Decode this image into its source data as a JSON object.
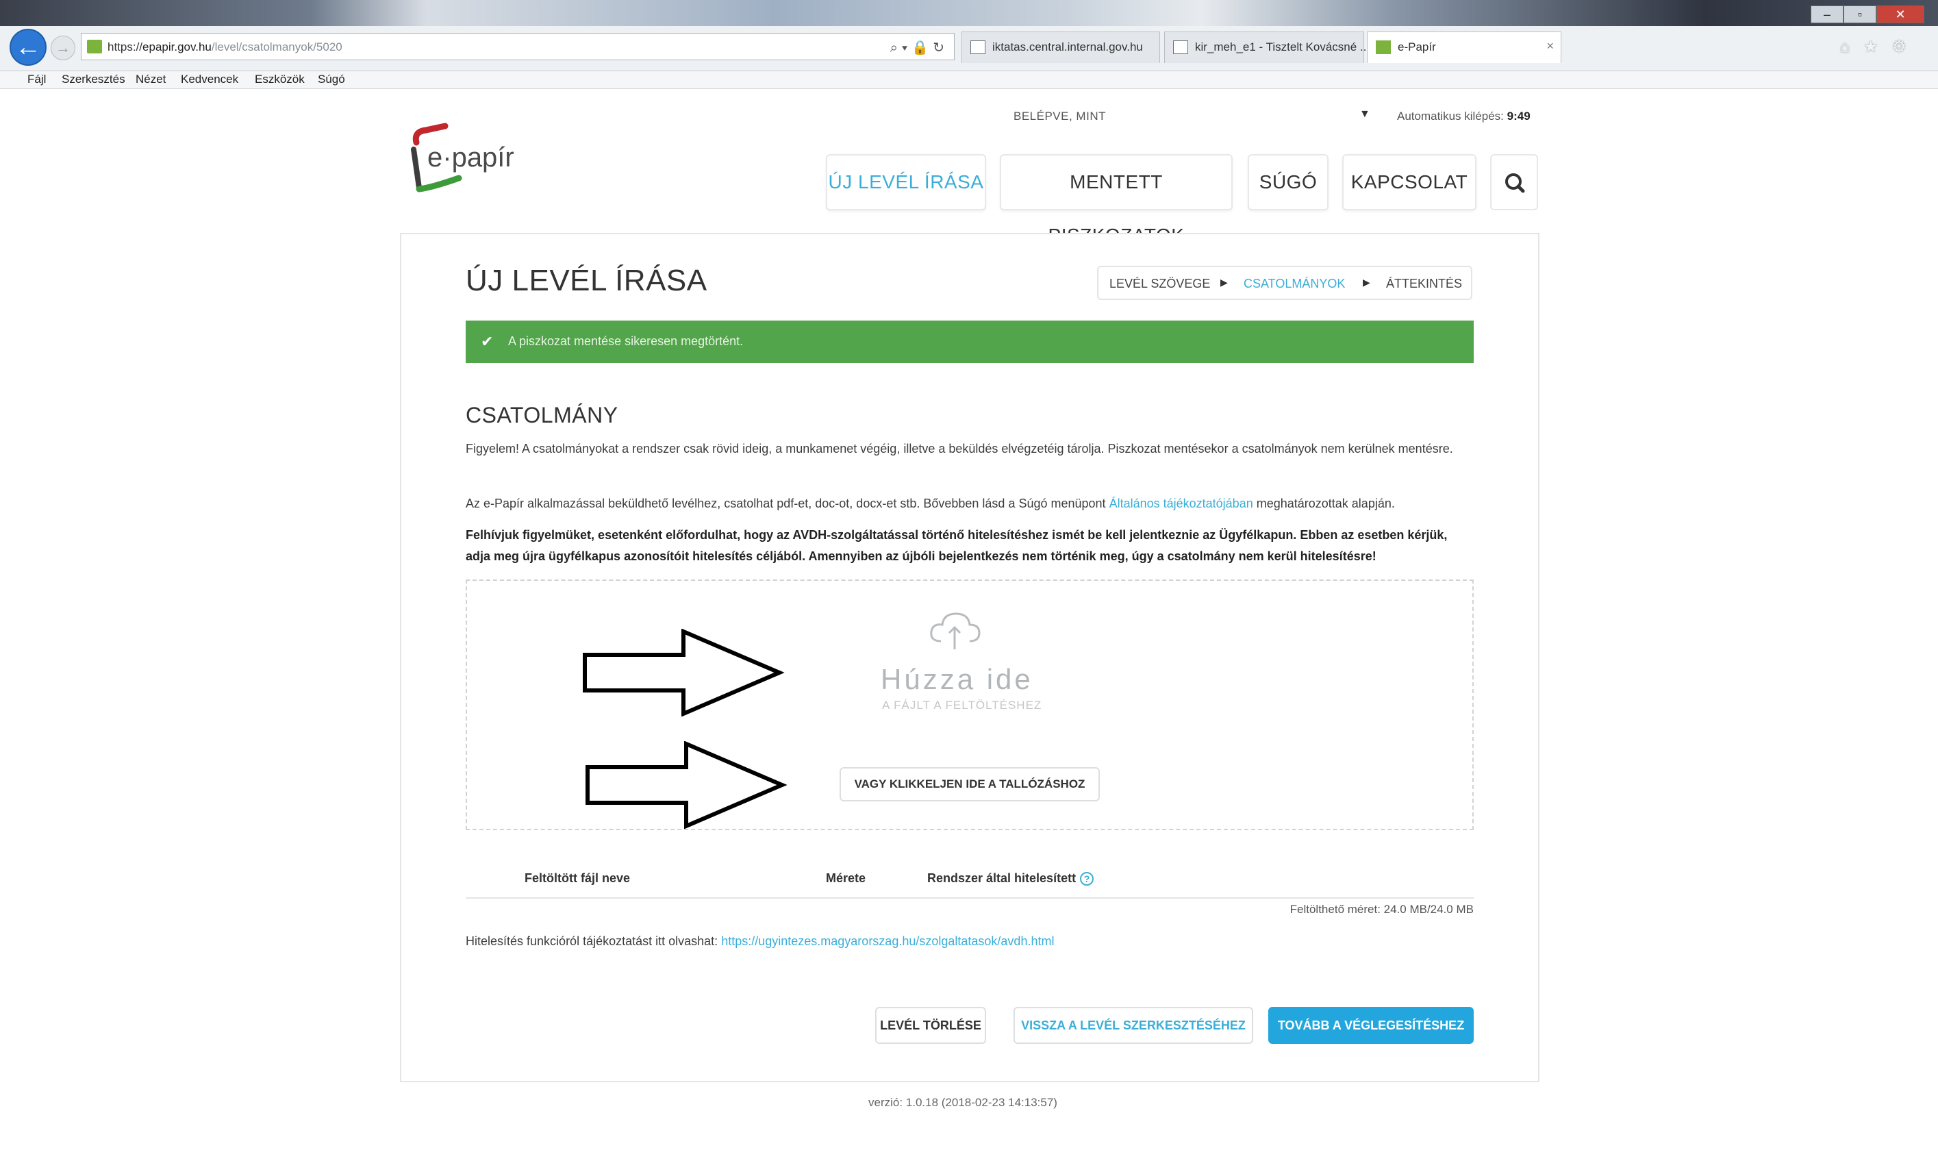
{
  "browser": {
    "address": {
      "scheme": "https",
      "host": "epapir.gov.hu",
      "path": "/level/csatolmanyok/5020"
    },
    "tabs": [
      {
        "label": "iktatas.central.internal.gov.hu"
      },
      {
        "label": "kir_meh_e1 - Tisztelt Kovácsné ..."
      },
      {
        "label": "e-Papír"
      }
    ],
    "menu": [
      "Fájl",
      "Szerkesztés",
      "Nézet",
      "Kedvencek",
      "Eszközök",
      "Súgó"
    ]
  },
  "header": {
    "logo_text": "e·papír",
    "login_label": "BELÉPVE, MINT",
    "autologout_label": "Automatikus kilépés:",
    "autologout_value": "9:49",
    "nav": [
      {
        "label": "ÚJ LEVÉL ÍRÁSA",
        "active": true
      },
      {
        "label": "MENTETT PISZKOZATOK"
      },
      {
        "label": "SÚGÓ"
      },
      {
        "label": "KAPCSOLAT"
      }
    ],
    "search_icon": "search-icon"
  },
  "main": {
    "title": "ÚJ LEVÉL ÍRÁSA",
    "steps": [
      "LEVÉL SZÖVEGE",
      "CSATOLMÁNYOK",
      "ÁTTEKINTÉS"
    ],
    "success_message": "A piszkozat mentése sikeresen megtörtént.",
    "section_title": "CSATOLMÁNY",
    "paragraphs": {
      "p1": "Figyelem! A csatolmányokat a rendszer csak rövid ideig, a munkamenet végéig, illetve a beküldés elvégzetéig tárolja. Piszkozat mentésekor a csatolmányok nem kerülnek mentésre.",
      "p2_before": "Az e-Papír alkalmazással beküldhető levélhez, csatolhat pdf-et, doc-ot, docx-et stb. Bővebben lásd a Súgó menüpont ",
      "p2_link": "Általános tájékoztatójában",
      "p2_after": " meghatározottak alapján.",
      "p3": "Felhívjuk figyelmüket, esetenként előfordulhat, hogy az AVDH-szolgáltatással történő hitelesítéshez ismét be kell jelentkeznie az Ügyfélkapun. Ebben az esetben kérjük, adja meg újra ügyfélkapus azonosítóit hitelesítés céljából. Amennyiben az újbóli bejelentkezés nem történik meg, úgy a csatolmány nem kerül hitelesítésre!"
    },
    "dropzone": {
      "title": "Húzza ide",
      "subtitle": "A FÁJLT A FELTÖLTÉSHEZ",
      "browse_label": "VAGY KLIKKELJEN IDE A TALLÓZÁSHOZ"
    },
    "table": {
      "columns": [
        "Feltöltött fájl neve",
        "Mérete",
        "Rendszer által hitelesített"
      ],
      "help_glyph": "?"
    },
    "upload_size": "Feltölthető méret: 24.0 MB/24.0 MB",
    "auth_info_label": "Hitelesítés funkcióról tájékoztatást itt olvashat:",
    "auth_info_link": "https://ugyintezes.magyarorszag.hu/szolgaltatasok/avdh.html",
    "buttons": {
      "delete": "LEVÉL TÖRLÉSE",
      "back": "VISSZA A LEVÉL SZERKESZTÉSÉHEZ",
      "next": "TOVÁBB A VÉGLEGESÍTÉSHEZ"
    }
  },
  "footer": {
    "version": "verzió: 1.0.18 (2018-02-23 14:13:57)"
  },
  "colors": {
    "accent": "#3aaed8",
    "success": "#52a54a",
    "primary_button": "#22a6dd"
  }
}
